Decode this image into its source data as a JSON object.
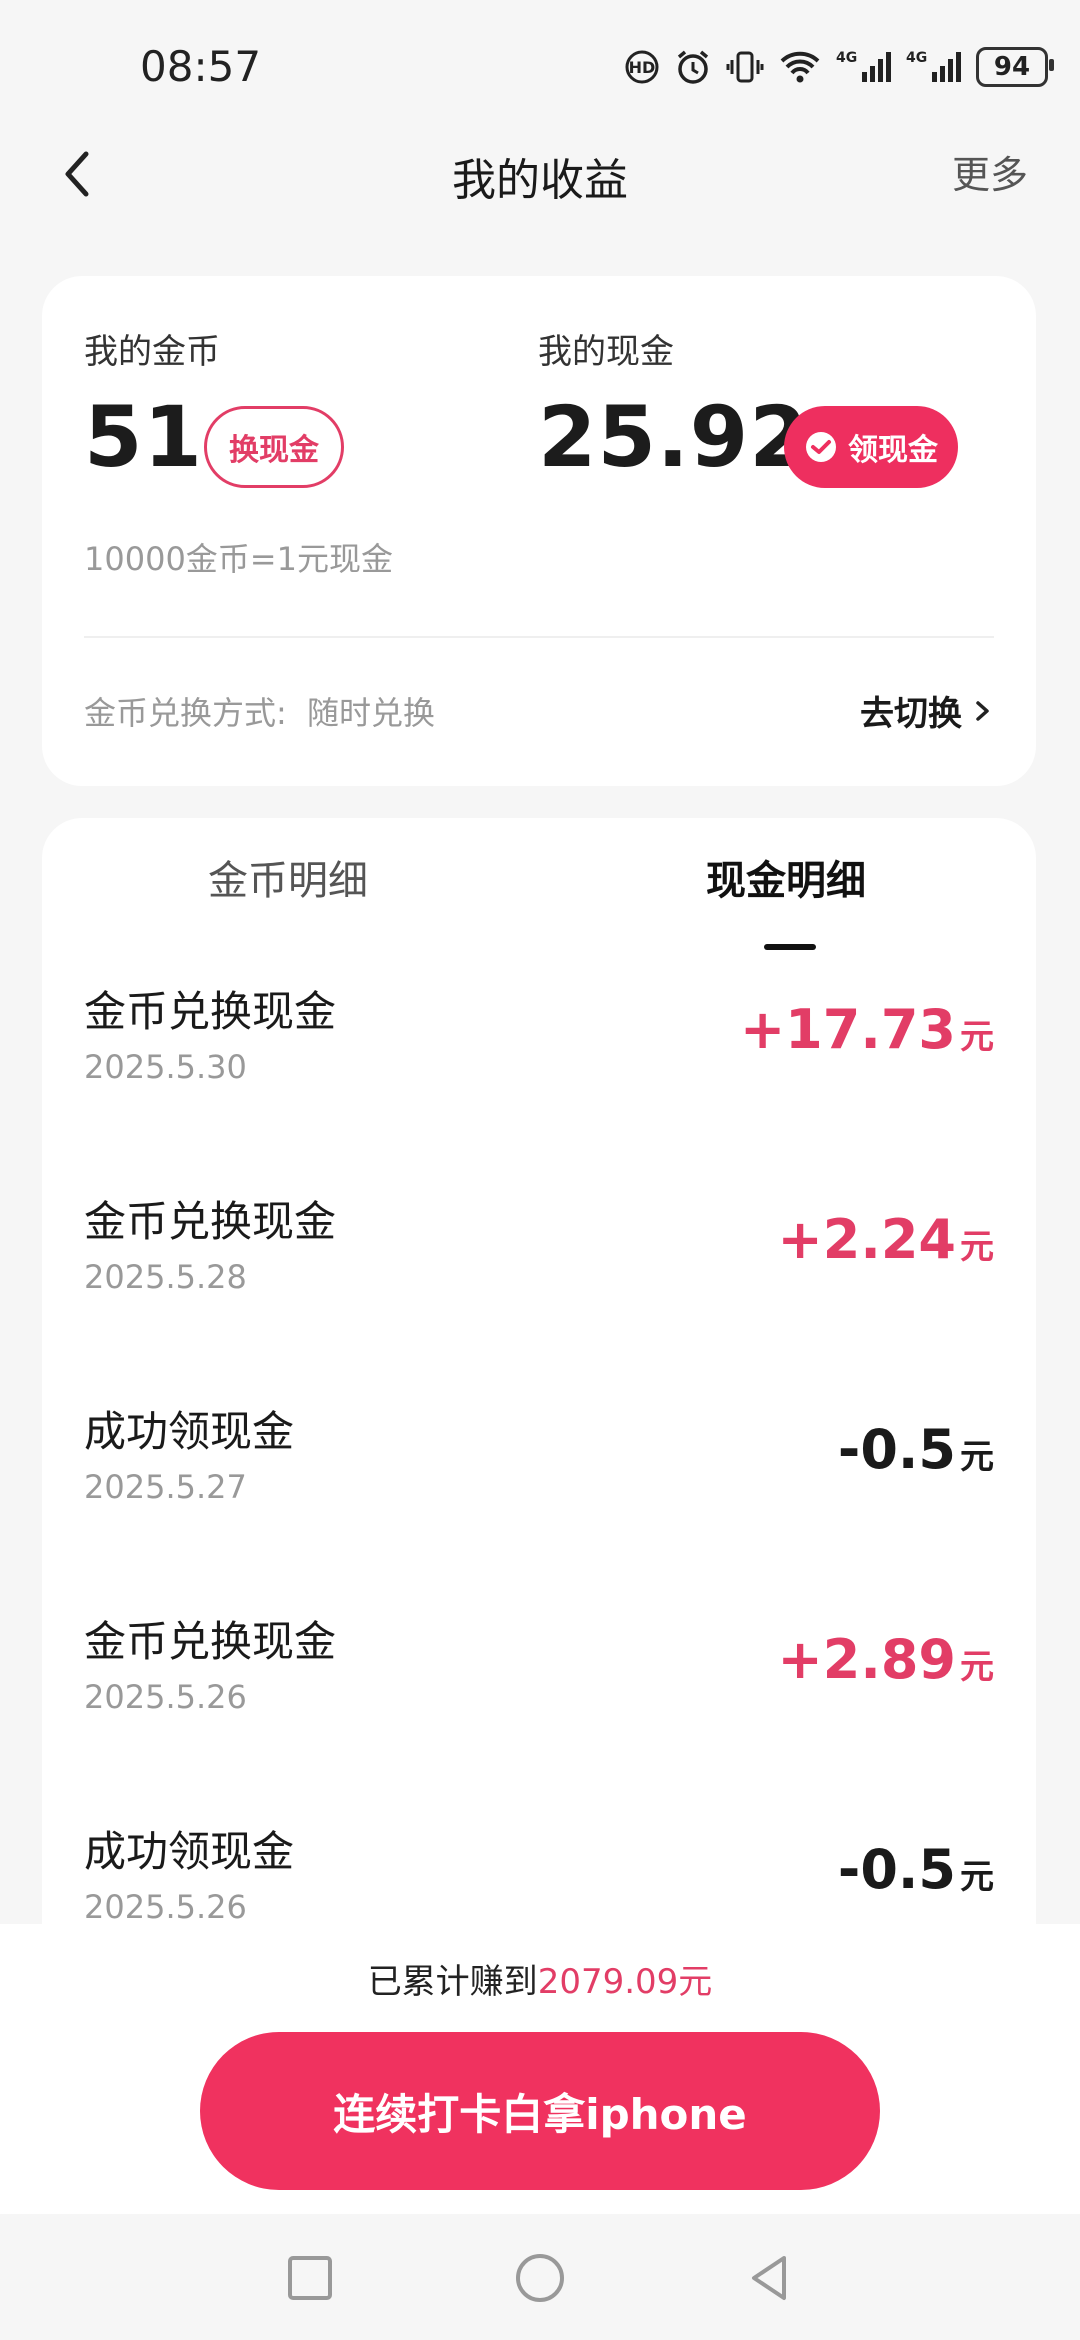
{
  "status_bar": {
    "time": "08:57",
    "battery": "94",
    "icons": [
      "hd-icon",
      "alarm-icon",
      "vibrate-icon",
      "wifi-icon",
      "4g-signal-icon",
      "4g-signal-icon",
      "battery-icon"
    ]
  },
  "header": {
    "title": "我的收益",
    "more": "更多"
  },
  "coins": {
    "label": "我的金币",
    "value": "51",
    "exchange_button": "换现金",
    "rate": "10000金币=1元现金"
  },
  "cash": {
    "label": "我的现金",
    "value": "25.92",
    "withdraw_button": "领现金"
  },
  "exchange_method": {
    "label": "金币兑换方式:",
    "value": "随时兑换",
    "switch_label": "去切换"
  },
  "tabs": [
    {
      "label": "金币明细",
      "active": false
    },
    {
      "label": "现金明细",
      "active": true
    }
  ],
  "records": [
    {
      "title": "金币兑换现金",
      "date": "2025.5.30",
      "amount": "+17.73",
      "unit": "元",
      "positive": true
    },
    {
      "title": "金币兑换现金",
      "date": "2025.5.28",
      "amount": "+2.24",
      "unit": "元",
      "positive": true
    },
    {
      "title": "成功领现金",
      "date": "2025.5.27",
      "amount": "-0.5",
      "unit": "元",
      "positive": false
    },
    {
      "title": "金币兑换现金",
      "date": "2025.5.26",
      "amount": "+2.89",
      "unit": "元",
      "positive": true
    },
    {
      "title": "成功领现金",
      "date": "2025.5.26",
      "amount": "-0.5",
      "unit": "元",
      "positive": false
    }
  ],
  "summary": {
    "prefix": "已累计赚到",
    "amount": "2079.09元"
  },
  "cta": "连续打卡白拿iphone",
  "colors": {
    "accent": "#ee2f5f",
    "accent_text": "#e23d66"
  }
}
